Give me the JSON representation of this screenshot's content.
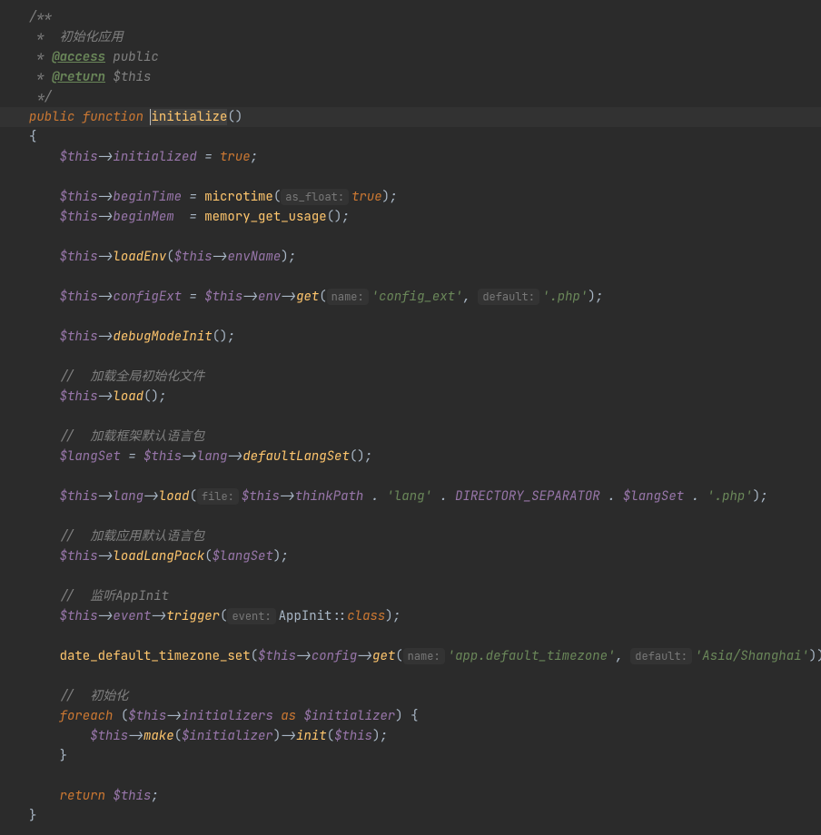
{
  "doc": {
    "open": "/**",
    "l1": " *  初始化应用",
    "l2a": " * ",
    "access_tag": "@access",
    "access_val": " public",
    "return_tag": "@return",
    "return_val": " $this",
    "close": " */"
  },
  "sig": {
    "public": "public",
    "function": "function",
    "name": "initialize",
    "parens": "()",
    "brace_open": "{",
    "brace_close": "}"
  },
  "l": {
    "this": "$this",
    "arrow": "->",
    "initialized": "initialized",
    "eq": " = ",
    "true": "true",
    "semi": ";",
    "beginTime": "beginTime",
    "microtime": "microtime",
    "op": "(",
    "cp": ")",
    "inlay_asfloat": "as_float:",
    "beginMem": "beginMem ",
    "memget": "memory_get_usage",
    "loadEnv": "loadEnv",
    "envName": "envName",
    "configExt": "configExt",
    "env": "env",
    "get": "get",
    "inlay_name": "name:",
    "str_config_ext": "'config_ext'",
    "comma": ", ",
    "inlay_default": "default:",
    "str_php": "'.php'",
    "debugModeInit": "debugModeInit",
    "cmt_global": "//  加载全局初始化文件",
    "load": "load",
    "cmt_frame": "//  加载框架默认语言包",
    "langSet": "$langSet",
    "lang": "lang",
    "defaultLangSet": "defaultLangSet",
    "inlay_file": "file:",
    "thinkPath": "thinkPath",
    "dot": " . ",
    "str_lang": "'lang'",
    "dirsep": "DIRECTORY_SEPARATOR",
    "cmt_app": "//  加载应用默认语言包",
    "loadLangPack": "loadLangPack",
    "cmt_listen": "//  监听AppInit",
    "event": "event",
    "trigger": "trigger",
    "inlay_event": "event:",
    "AppInit": "AppInit",
    "dblcol": "::",
    "classkw": "class",
    "datedefset": "date_default_timezone_set",
    "config": "config",
    "str_apptz": "'app.default_timezone'",
    "str_shanghai": "'Asia/Shanghai'",
    "cmt_init": "//  初始化",
    "foreach": "foreach",
    "initializers": "initializers",
    "as": "as",
    "initializer": "$initializer",
    "bro": " {",
    "make": "make",
    "init": "init",
    "brc": "}",
    "return": "return"
  }
}
